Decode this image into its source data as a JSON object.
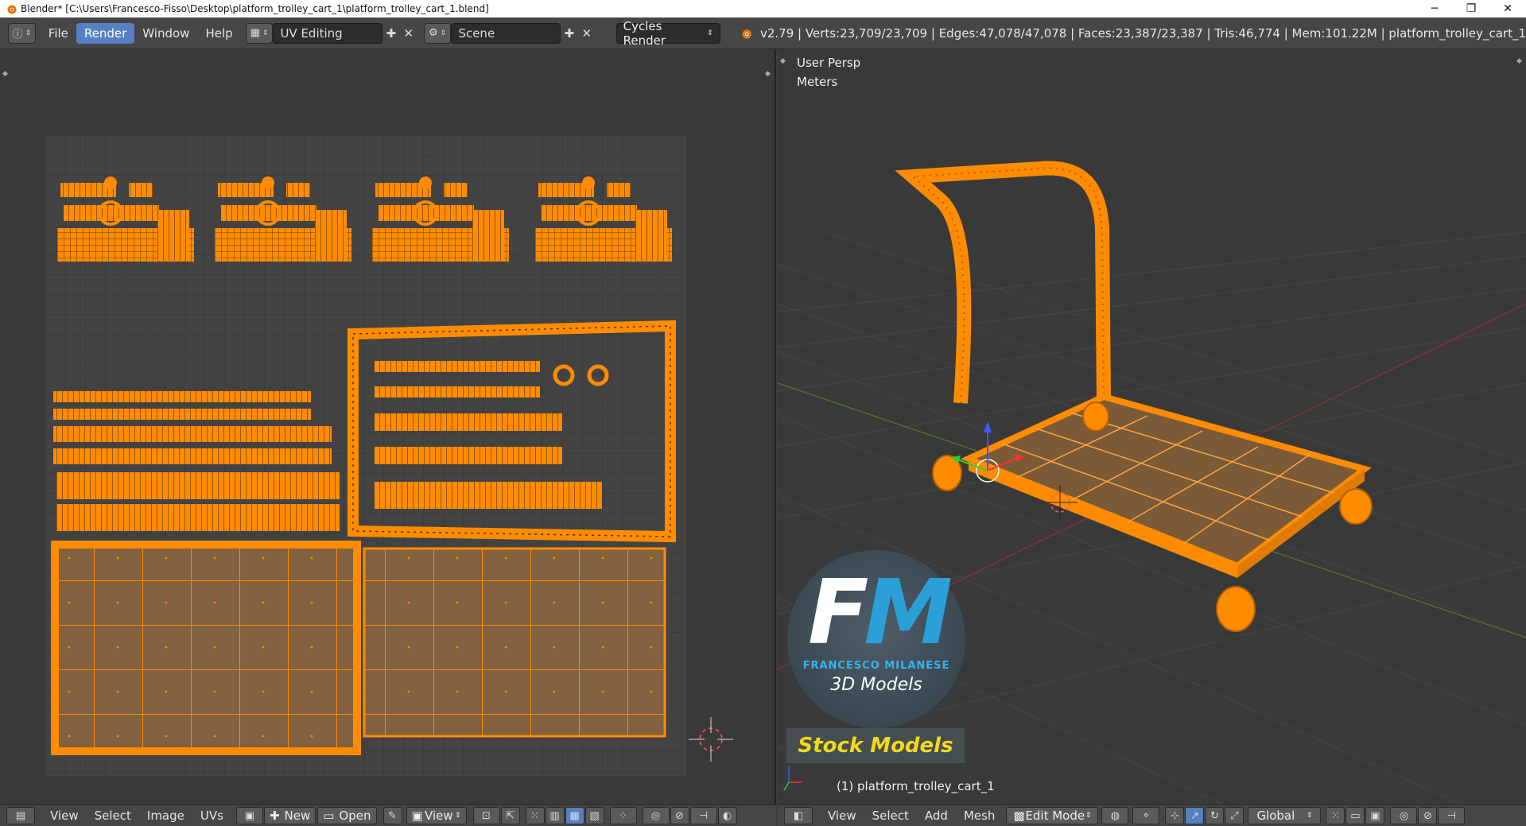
{
  "window": {
    "title": "Blender* [C:\\Users\\Francesco-Fisso\\Desktop\\platform_trolley_cart_1\\platform_trolley_cart_1.blend]",
    "minimize": "─",
    "restore": "❐",
    "close": "✕"
  },
  "menu": {
    "file": "File",
    "render": "Render",
    "window": "Window",
    "help": "Help"
  },
  "screen_layout": "UV Editing",
  "scene": "Scene",
  "render_engine": "Cycles Render",
  "stats": "v2.79 | Verts:23,709/23,709 | Edges:47,078/47,078 | Faces:23,387/23,387 | Tris:46,774 | Mem:101.22M | platform_trolley_cart_1",
  "viewport": {
    "view_name": "User Persp",
    "units": "Meters",
    "object_label": "(1) platform_trolley_cart_1"
  },
  "watermark": {
    "initials_f": "F",
    "initials_m": "M",
    "name": "FRANCESCO MILANESE",
    "tagline": "3D Models",
    "banner": "Stock Models"
  },
  "uv_footer": {
    "view": "View",
    "select": "Select",
    "image": "Image",
    "uvs": "UVs",
    "new": "New",
    "open": "Open",
    "view_btn": "View"
  },
  "vp_footer": {
    "view": "View",
    "select": "Select",
    "add": "Add",
    "mesh": "Mesh",
    "mode": "Edit Mode",
    "orientation": "Global"
  },
  "colors": {
    "accent_blue": "#5680c2",
    "uv_orange": "#ff8c00",
    "fm_blue": "#2a9fd8",
    "stock_yellow": "#f2d91a"
  },
  "icons": {
    "blender": "blender-logo-icon",
    "info": "info-icon",
    "layout": "screen-layout-icon",
    "scene": "scene-icon",
    "add": "plus-icon",
    "remove": "x-icon"
  }
}
